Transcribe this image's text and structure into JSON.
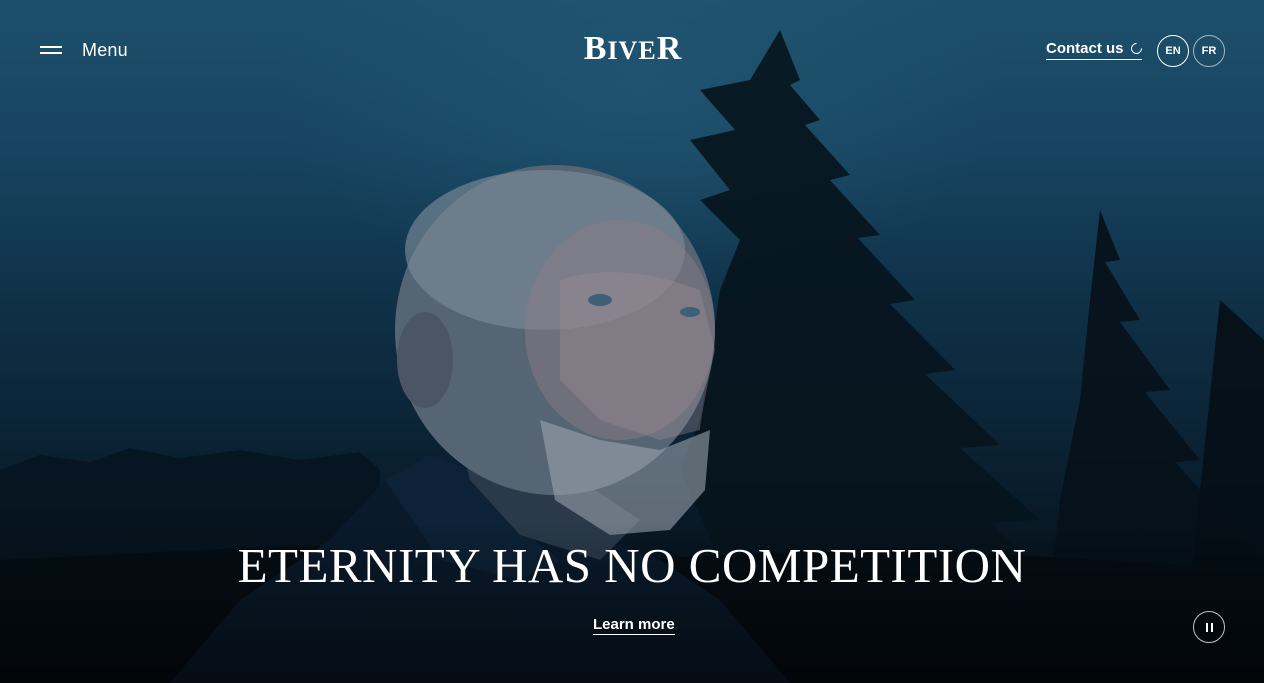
{
  "header": {
    "menu_label": "Menu",
    "logo": {
      "b": "B",
      "ive": "IVE",
      "r": "R"
    },
    "contact_label": "Contact us",
    "languages": [
      "EN",
      "FR"
    ],
    "active_language": "EN"
  },
  "hero": {
    "headline": "ETERNITY HAS NO COMPETITION",
    "cta_label": "Learn more"
  },
  "icons": {
    "menu": "hamburger-icon",
    "contact": "external-link-icon",
    "pause": "pause-icon"
  },
  "colors": {
    "text": "#ffffff",
    "sky": "#174460",
    "shadow": "#040b12"
  }
}
